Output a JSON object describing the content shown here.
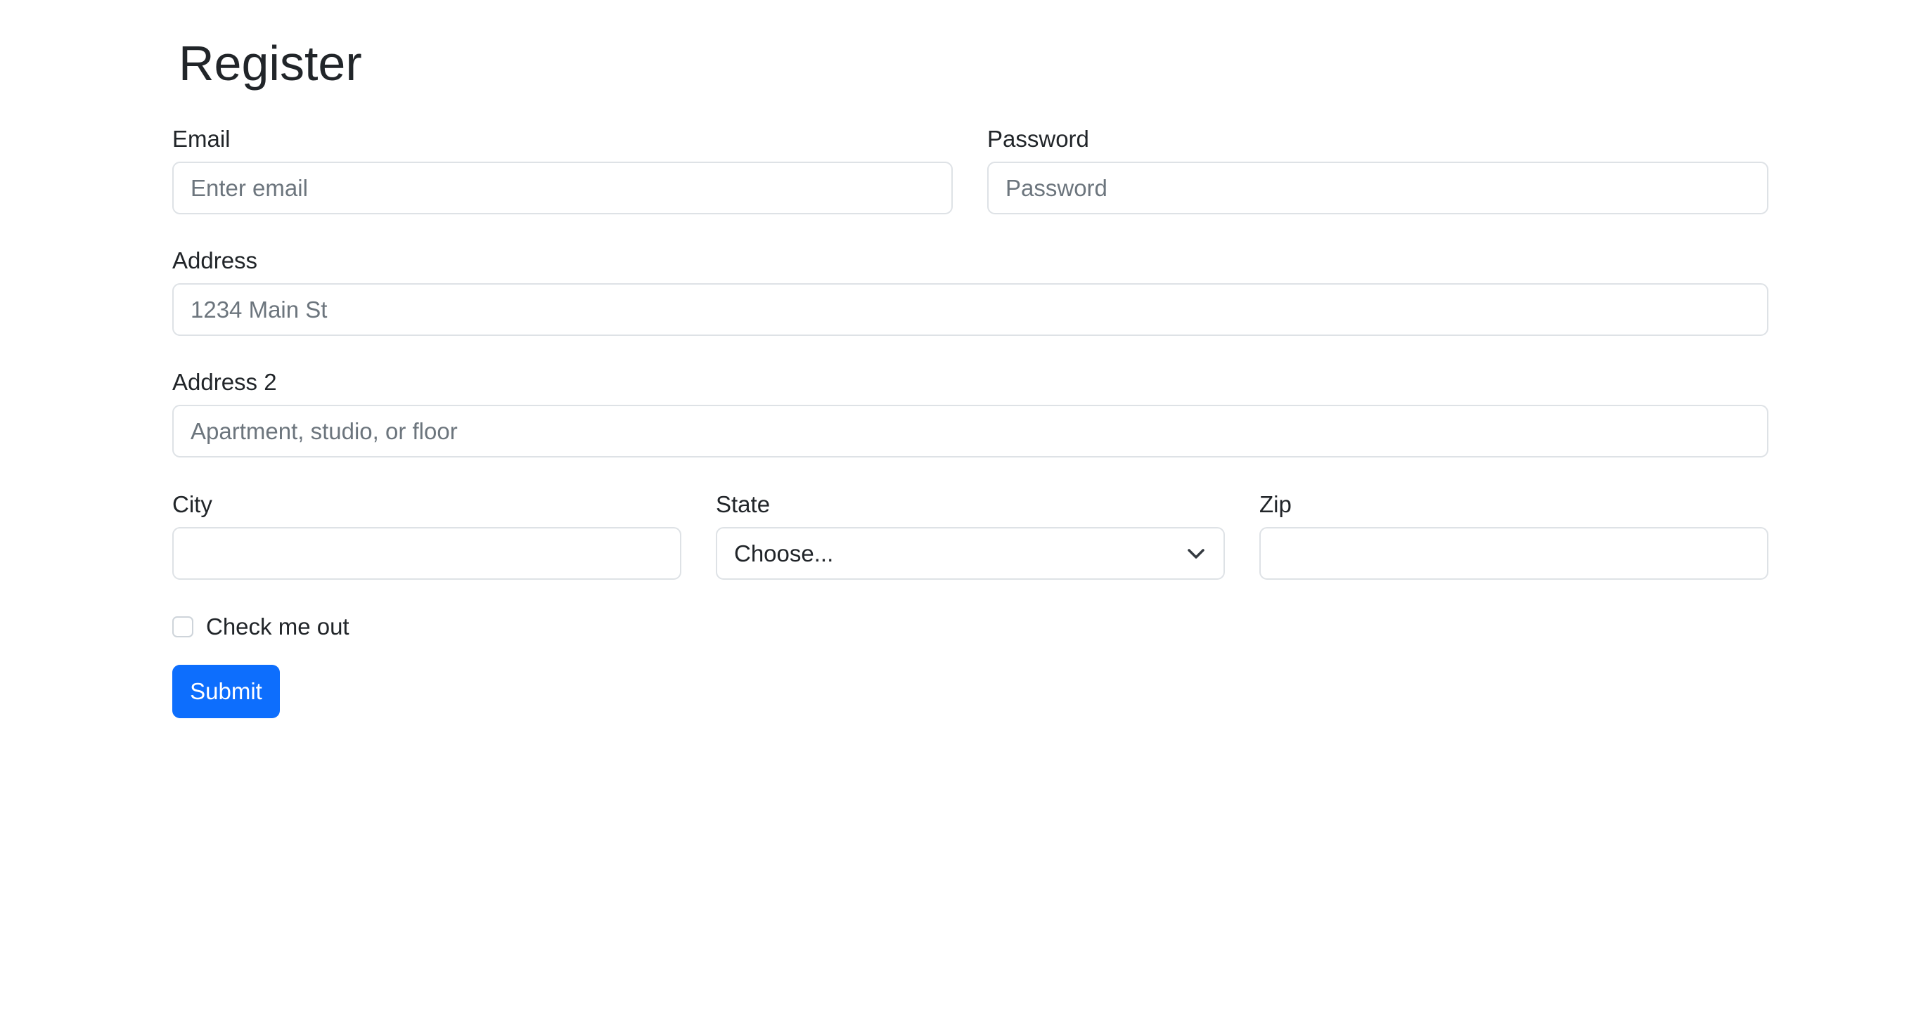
{
  "page": {
    "title": "Register"
  },
  "form": {
    "email": {
      "label": "Email",
      "placeholder": "Enter email",
      "value": ""
    },
    "password": {
      "label": "Password",
      "placeholder": "Password",
      "value": ""
    },
    "address": {
      "label": "Address",
      "placeholder": "1234 Main St",
      "value": ""
    },
    "address2": {
      "label": "Address 2",
      "placeholder": "Apartment, studio, or floor",
      "value": ""
    },
    "city": {
      "label": "City",
      "value": ""
    },
    "state": {
      "label": "State",
      "selected": "Choose...",
      "icon": "chevron-down-icon"
    },
    "zip": {
      "label": "Zip",
      "value": ""
    },
    "check": {
      "label": "Check me out",
      "checked": false
    },
    "submit_label": "Submit"
  },
  "colors": {
    "primary": "#0d6efd",
    "text": "#212529",
    "placeholder": "#6c757d",
    "border": "#dee2e6"
  }
}
